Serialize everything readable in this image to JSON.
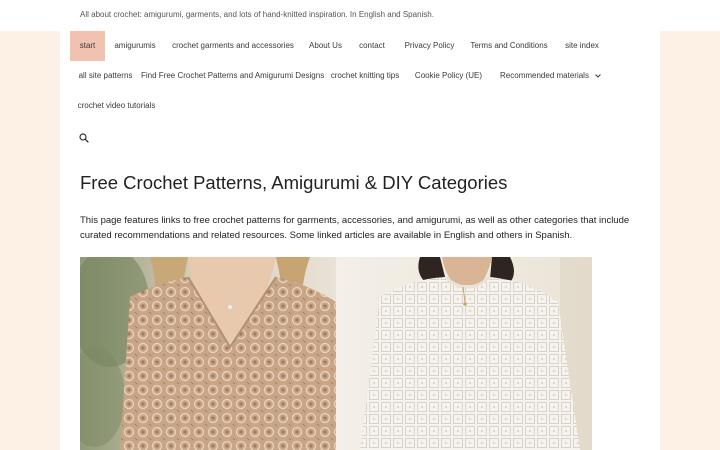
{
  "header": {
    "tagline": "All about crochet: amigurumi, garments, and lots of hand-knitted inspiration. In English and Spanish."
  },
  "nav": {
    "row1": [
      {
        "label": "start",
        "active": true
      },
      {
        "label": "amigurumis"
      },
      {
        "label": "crochet garments and accessories"
      },
      {
        "label": "About Us"
      },
      {
        "label": "contact"
      },
      {
        "label": "Privacy Policy"
      },
      {
        "label": "Terms and Conditions"
      },
      {
        "label": "site index"
      }
    ],
    "row2": [
      {
        "label": "all site patterns"
      },
      {
        "label": "Find Free Crochet Patterns and Amigurumi Designs"
      },
      {
        "label": "crochet knitting tips"
      },
      {
        "label": "Cookie Policy (UE)"
      },
      {
        "label": "Recommended materials",
        "has_dropdown": true
      }
    ],
    "row3": [
      {
        "label": "crochet video tutorials"
      }
    ],
    "search_icon": "search-icon"
  },
  "main": {
    "title": "Free Crochet Patterns, Amigurumi & DIY Categories",
    "intro": "This page features links to free crochet patterns for garments, accessories, and amigurumi, as well as other categories that include curated recommendations and related resources. Some linked articles are available in English and others in Spanish."
  },
  "colors": {
    "page_bg": "#fdf1e6",
    "active_nav_bg": "#f2c2b0",
    "text": "#222222"
  }
}
